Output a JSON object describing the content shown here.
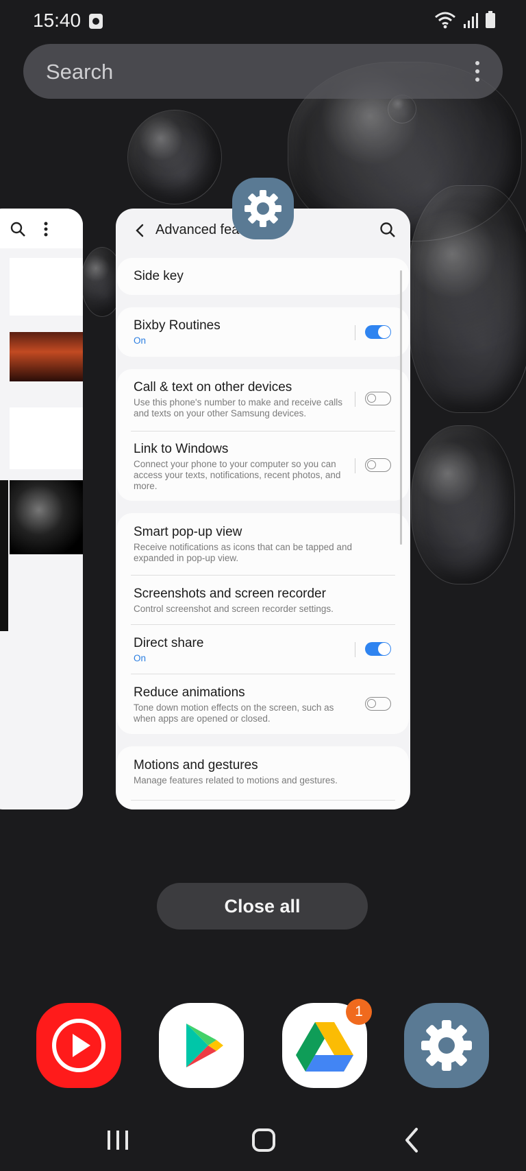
{
  "status_bar": {
    "time": "15:40"
  },
  "search": {
    "placeholder": "Search"
  },
  "recents": {
    "card_title": "Advanced features",
    "groups": [
      [
        {
          "title": "Side key",
          "subtitle": "",
          "state": "",
          "toggle": null
        }
      ],
      [
        {
          "title": "Bixby Routines",
          "subtitle": "",
          "state": "On",
          "toggle": true
        }
      ],
      [
        {
          "title": "Call & text on other devices",
          "subtitle": "Use this phone's number to make and receive calls and texts on your other Samsung devices.",
          "state": "",
          "toggle": false
        },
        {
          "title": "Link to Windows",
          "subtitle": "Connect your phone to your computer so you can access your texts, notifications, recent photos, and more.",
          "state": "",
          "toggle": false
        }
      ],
      [
        {
          "title": "Smart pop-up view",
          "subtitle": "Receive notifications as icons that can be tapped and expanded in pop-up view.",
          "state": "",
          "toggle": null
        },
        {
          "title": "Screenshots and screen recorder",
          "subtitle": "Control screenshot and screen recorder settings.",
          "state": "",
          "toggle": null
        },
        {
          "title": "Direct share",
          "subtitle": "",
          "state": "On",
          "toggle": true
        },
        {
          "title": "Reduce animations",
          "subtitle": "Tone down motion effects on the screen, such as when apps are opened or closed.",
          "state": "",
          "toggle": false
        }
      ],
      [
        {
          "title": "Motions and gestures",
          "subtitle": "Manage features related to motions and gestures.",
          "state": "",
          "toggle": null
        }
      ]
    ],
    "close_all_label": "Close all"
  },
  "dock": {
    "drive_badge": "1",
    "apps": [
      "youtube-music-icon",
      "play-store-icon",
      "google-drive-icon",
      "settings-icon"
    ]
  },
  "colors": {
    "accent": "#2f84f0",
    "settings_icon": "#5a7a94",
    "badge": "#f06a1e"
  }
}
